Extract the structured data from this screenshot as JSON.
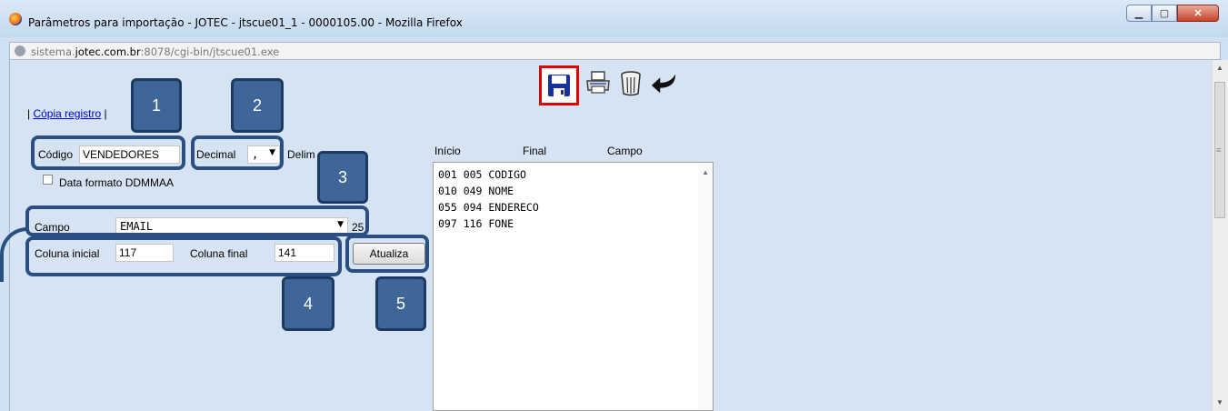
{
  "window": {
    "title": "Parâmetros para importação - JOTEC - jtscue01_1 - 0000105.00 - Mozilla Firefox",
    "minimize_label": "▁",
    "maximize_label": "▢",
    "close_label": "✕"
  },
  "urlbar": {
    "url_prefix": "sistema.",
    "url_domain": "jotec.com.br",
    "url_rest": ":8078/cgi-bin/jtscue01.exe"
  },
  "toolbar": {
    "icons": [
      "save-icon",
      "print-icon",
      "trash-icon",
      "back-arrow-icon"
    ]
  },
  "links": {
    "pipe_left": "| ",
    "copia_registro": "Cópia registro",
    "pipe_right": " |"
  },
  "form": {
    "codigo_label": "Código",
    "codigo_value": "VENDEDORES",
    "decimal_label": "Decimal",
    "decimal_value": ",",
    "delimitador_label": "Delim",
    "data_formato_label": "Data formato DDMMAA",
    "campo_label": "Campo",
    "campo_value": "EMAIL",
    "campo_size": "25",
    "coluna_inicial_label": "Coluna inicial",
    "coluna_inicial_value": "117",
    "coluna_final_label": "Coluna final",
    "coluna_final_value": "141",
    "atualiza_label": "Atualiza"
  },
  "list": {
    "headers": [
      "Início",
      "Final",
      "Campo"
    ],
    "rows": [
      "001 005 CODIGO",
      "010 049 NOME",
      "055 094 ENDERECO",
      "097 116 FONE"
    ]
  },
  "callouts": [
    "1",
    "2",
    "3",
    "4",
    "5"
  ],
  "colors": {
    "callout_fill": "#3e6699",
    "callout_border": "#2c4f82",
    "save_highlight": "#e00000",
    "content_bg": "#d6e3f3"
  }
}
